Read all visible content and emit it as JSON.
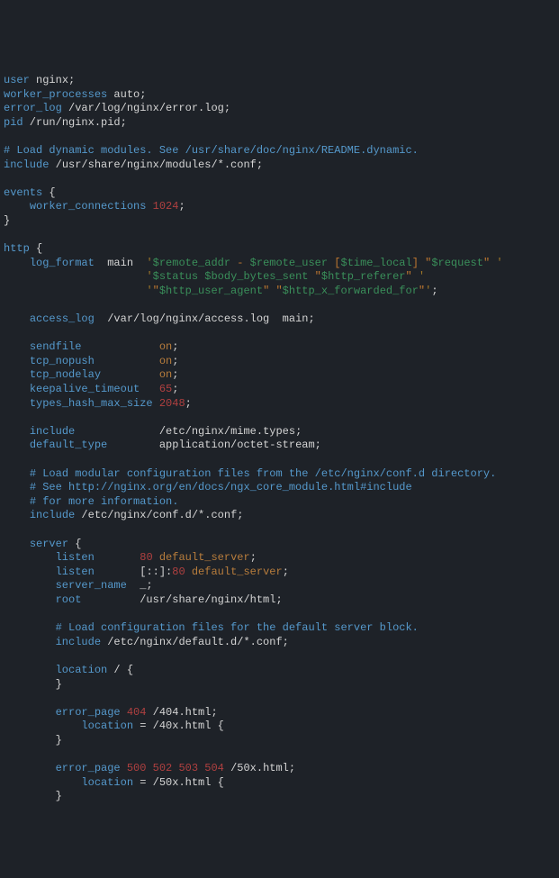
{
  "lines": [
    [
      [
        "kw",
        "user"
      ],
      [
        "",
        " "
      ],
      [
        "",
        "nginx"
      ],
      [
        "",
        ";"
      ]
    ],
    [
      [
        "kw",
        "worker_processes"
      ],
      [
        "",
        " "
      ],
      [
        "",
        "auto"
      ],
      [
        "",
        ";"
      ]
    ],
    [
      [
        "kw",
        "error_log"
      ],
      [
        "",
        " "
      ],
      [
        "",
        "/var/log/nginx/error.log"
      ],
      [
        "",
        ";"
      ]
    ],
    [
      [
        "kw",
        "pid"
      ],
      [
        "",
        " "
      ],
      [
        "",
        "/run/nginx.pid"
      ],
      [
        "",
        ";"
      ]
    ],
    [
      [
        "",
        ""
      ]
    ],
    [
      [
        "cmt",
        "# Load dynamic modules. See /usr/share/doc/nginx/README.dynamic."
      ]
    ],
    [
      [
        "kw",
        "include"
      ],
      [
        "",
        " "
      ],
      [
        "",
        "/usr/share/nginx/modules/*.conf"
      ],
      [
        "",
        ";"
      ]
    ],
    [
      [
        "",
        ""
      ]
    ],
    [
      [
        "kw",
        "events"
      ],
      [
        "",
        " "
      ],
      [
        "",
        "{"
      ]
    ],
    [
      [
        "",
        "    "
      ],
      [
        "kw",
        "worker_connections"
      ],
      [
        "",
        " "
      ],
      [
        "num",
        "1024"
      ],
      [
        "",
        ";"
      ]
    ],
    [
      [
        "",
        "}"
      ]
    ],
    [
      [
        "",
        ""
      ]
    ],
    [
      [
        "kw",
        "http"
      ],
      [
        "",
        " "
      ],
      [
        "",
        "{"
      ]
    ],
    [
      [
        "",
        "    "
      ],
      [
        "kw",
        "log_format"
      ],
      [
        "",
        "  main  "
      ],
      [
        "c1",
        "'"
      ],
      [
        "var",
        "$remote_addr"
      ],
      [
        "orange",
        " - "
      ],
      [
        "var",
        "$remote_user"
      ],
      [
        "orange",
        " ["
      ],
      [
        "var",
        "$time_local"
      ],
      [
        "orange",
        "] \""
      ],
      [
        "var",
        "$request"
      ],
      [
        "orange",
        "\" "
      ],
      [
        "c1",
        "'"
      ]
    ],
    [
      [
        "",
        "                      "
      ],
      [
        "c1",
        "'"
      ],
      [
        "var",
        "$status"
      ],
      [
        "orange",
        " "
      ],
      [
        "var",
        "$body_bytes_sent"
      ],
      [
        "orange",
        " \""
      ],
      [
        "var",
        "$http_referer"
      ],
      [
        "orange",
        "\" "
      ],
      [
        "c1",
        "'"
      ]
    ],
    [
      [
        "",
        "                      "
      ],
      [
        "c1",
        "'"
      ],
      [
        "orange",
        "\""
      ],
      [
        "var",
        "$http_user_agent"
      ],
      [
        "orange",
        "\" \""
      ],
      [
        "var",
        "$http_x_forwarded_for"
      ],
      [
        "orange",
        "\""
      ],
      [
        "c1",
        "'"
      ],
      [
        "",
        ";"
      ]
    ],
    [
      [
        "",
        ""
      ]
    ],
    [
      [
        "",
        "    "
      ],
      [
        "kw",
        "access_log"
      ],
      [
        "",
        "  /var/log/nginx/access.log  main;"
      ]
    ],
    [
      [
        "",
        ""
      ]
    ],
    [
      [
        "",
        "    "
      ],
      [
        "kw",
        "sendfile"
      ],
      [
        "",
        "            "
      ],
      [
        "lit",
        "on"
      ],
      [
        "",
        ";"
      ]
    ],
    [
      [
        "",
        "    "
      ],
      [
        "kw",
        "tcp_nopush"
      ],
      [
        "",
        "          "
      ],
      [
        "lit",
        "on"
      ],
      [
        "",
        ";"
      ]
    ],
    [
      [
        "",
        "    "
      ],
      [
        "kw",
        "tcp_nodelay"
      ],
      [
        "",
        "         "
      ],
      [
        "lit",
        "on"
      ],
      [
        "",
        ";"
      ]
    ],
    [
      [
        "",
        "    "
      ],
      [
        "kw",
        "keepalive_timeout"
      ],
      [
        "",
        "   "
      ],
      [
        "num",
        "65"
      ],
      [
        "",
        ";"
      ]
    ],
    [
      [
        "",
        "    "
      ],
      [
        "kw",
        "types_hash_max_size"
      ],
      [
        "",
        " "
      ],
      [
        "num",
        "2048"
      ],
      [
        "",
        ";"
      ]
    ],
    [
      [
        "",
        ""
      ]
    ],
    [
      [
        "",
        "    "
      ],
      [
        "kw",
        "include"
      ],
      [
        "",
        "             /etc/nginx/mime.types;"
      ]
    ],
    [
      [
        "",
        "    "
      ],
      [
        "kw",
        "default_type"
      ],
      [
        "",
        "        application/octet-stream;"
      ]
    ],
    [
      [
        "",
        ""
      ]
    ],
    [
      [
        "",
        "    "
      ],
      [
        "cmt",
        "# Load modular configuration files from the /etc/nginx/conf.d directory."
      ]
    ],
    [
      [
        "",
        "    "
      ],
      [
        "cmt",
        "# See http://nginx.org/en/docs/ngx_core_module.html#include"
      ]
    ],
    [
      [
        "",
        "    "
      ],
      [
        "cmt",
        "# for more information."
      ]
    ],
    [
      [
        "",
        "    "
      ],
      [
        "kw",
        "include"
      ],
      [
        "",
        " /etc/nginx/conf.d/*.conf;"
      ]
    ],
    [
      [
        "",
        ""
      ]
    ],
    [
      [
        "",
        "    "
      ],
      [
        "kw",
        "server"
      ],
      [
        "",
        " {"
      ]
    ],
    [
      [
        "",
        "        "
      ],
      [
        "kw",
        "listen"
      ],
      [
        "",
        "       "
      ],
      [
        "num",
        "80"
      ],
      [
        "",
        " "
      ],
      [
        "lit",
        "default_server"
      ],
      [
        "",
        ";"
      ]
    ],
    [
      [
        "",
        "        "
      ],
      [
        "kw",
        "listen"
      ],
      [
        "",
        "       [::]:"
      ],
      [
        "num",
        "80"
      ],
      [
        "",
        " "
      ],
      [
        "lit",
        "default_server"
      ],
      [
        "",
        ";"
      ]
    ],
    [
      [
        "",
        "        "
      ],
      [
        "kw",
        "server_name"
      ],
      [
        "",
        "  _;"
      ]
    ],
    [
      [
        "",
        "        "
      ],
      [
        "kw",
        "root"
      ],
      [
        "",
        "         /usr/share/nginx/html;"
      ]
    ],
    [
      [
        "",
        ""
      ]
    ],
    [
      [
        "",
        "        "
      ],
      [
        "cmt",
        "# Load configuration files for the default server block."
      ]
    ],
    [
      [
        "",
        "        "
      ],
      [
        "kw",
        "include"
      ],
      [
        "",
        " /etc/nginx/default.d/*.conf;"
      ]
    ],
    [
      [
        "",
        ""
      ]
    ],
    [
      [
        "",
        "        "
      ],
      [
        "kw",
        "location"
      ],
      [
        "",
        " / {"
      ]
    ],
    [
      [
        "",
        "        }"
      ]
    ],
    [
      [
        "",
        ""
      ]
    ],
    [
      [
        "",
        "        "
      ],
      [
        "kw",
        "error_page"
      ],
      [
        "",
        " "
      ],
      [
        "num",
        "404"
      ],
      [
        "",
        " /404.html;"
      ]
    ],
    [
      [
        "",
        "            "
      ],
      [
        "kw",
        "location"
      ],
      [
        "",
        " = /40x.html {"
      ]
    ],
    [
      [
        "",
        "        }"
      ]
    ],
    [
      [
        "",
        ""
      ]
    ],
    [
      [
        "",
        "        "
      ],
      [
        "kw",
        "error_page"
      ],
      [
        "",
        " "
      ],
      [
        "num",
        "500"
      ],
      [
        "",
        " "
      ],
      [
        "num",
        "502"
      ],
      [
        "",
        " "
      ],
      [
        "num",
        "503"
      ],
      [
        "",
        " "
      ],
      [
        "num",
        "504"
      ],
      [
        "",
        " /50x.html;"
      ]
    ],
    [
      [
        "",
        "            "
      ],
      [
        "kw",
        "location"
      ],
      [
        "",
        " = /50x.html {"
      ]
    ],
    [
      [
        "",
        "        }"
      ]
    ]
  ]
}
